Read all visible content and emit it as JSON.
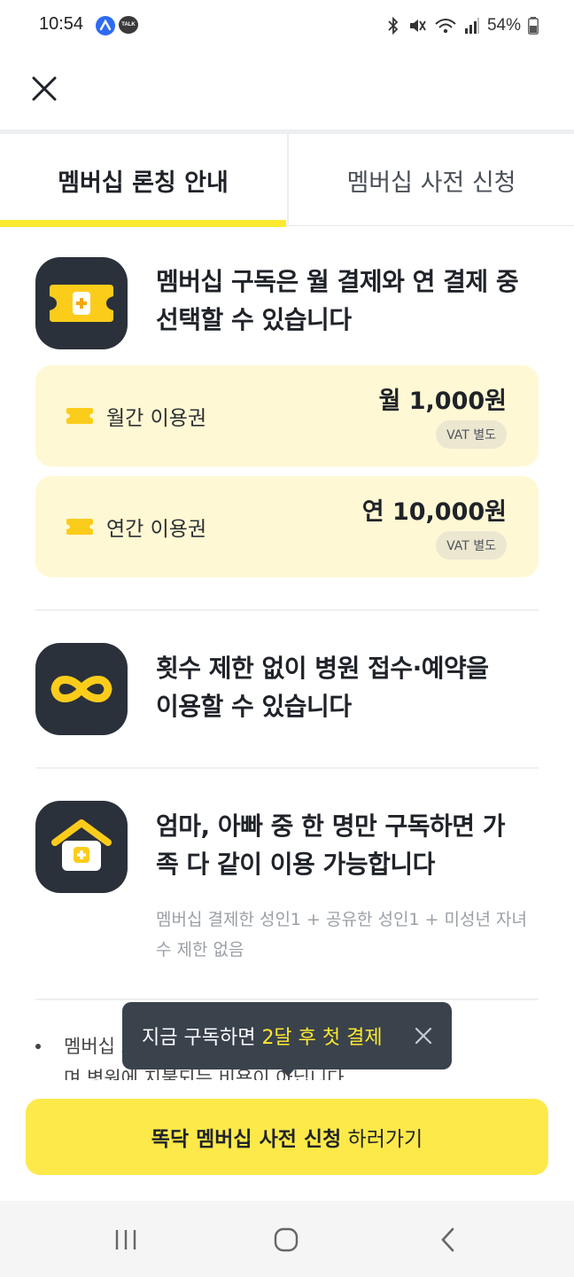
{
  "status_bar": {
    "time": "10:54",
    "battery": "54%",
    "icons": [
      "app-icon",
      "talk-icon",
      "bluetooth-icon",
      "mute-icon",
      "wifi-icon",
      "signal-icon",
      "battery-icon"
    ],
    "talk_label": "TALK"
  },
  "header": {
    "close_icon": "close-icon"
  },
  "tabs": [
    {
      "label": "멤버십 론칭 안내",
      "active": true
    },
    {
      "label": "멤버십 사전 신청",
      "active": false
    }
  ],
  "features": [
    {
      "icon": "ticket-icon",
      "title_line1": "멤버십 구독은 월 결제와 연 결제 중",
      "title_line2": "선택할 수 있습니다"
    },
    {
      "icon": "infinity-icon",
      "title_line1": "횟수 제한 없이 병원 접수·예약을",
      "title_line2": "이용할 수 있습니다"
    },
    {
      "icon": "house-icon",
      "title_line1": "엄마, 아빠 중 한 명만 구독하면 가",
      "title_line2": "족 다 같이 이용 가능합니다",
      "note": "멤버십 결제한 성인1 + 공유한 성인1 + 미성년 자녀 수 제한 없음"
    }
  ],
  "plans": [
    {
      "name": "월간 이용권",
      "price": "월 1,000원",
      "badge": "VAT 별도"
    },
    {
      "name": "연간 이용권",
      "price": "연 10,000원",
      "badge": "VAT 별도"
    }
  ],
  "bullet": {
    "text_line1": "멤버십 로 사용되",
    "text_line2": "며 병원에 지불되는 비용이 아닙니다"
  },
  "toast": {
    "prefix": "지금 구독하면 ",
    "highlight": "2달 후 첫 결제"
  },
  "cta": {
    "label_bold": "똑닥 멤버십 사전 신청",
    "label_rest": " 하러가기"
  },
  "colors": {
    "accent_yellow": "#fde930",
    "card_bg": "#fff8d4",
    "icon_bg": "#2b313a",
    "toast_bg": "#3a424c"
  }
}
